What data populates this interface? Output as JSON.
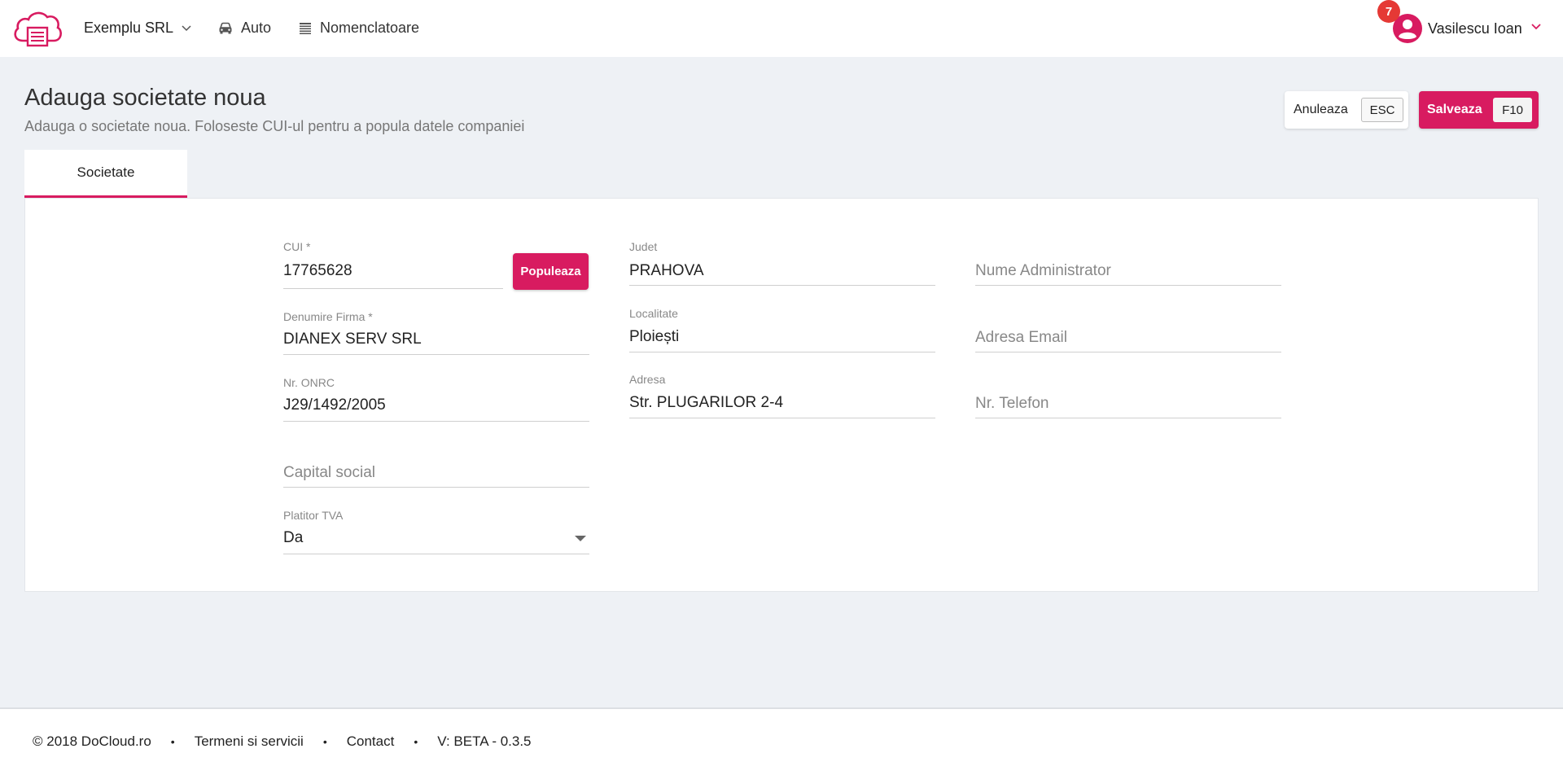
{
  "header": {
    "company": "Exemplu SRL",
    "nav": [
      {
        "label": "Auto",
        "icon": "car-icon"
      },
      {
        "label": "Nomenclatoare",
        "icon": "list-icon"
      }
    ],
    "notifications_count": "7",
    "user_name": "Vasilescu Ioan"
  },
  "page": {
    "title": "Adauga societate noua",
    "subtitle": "Adauga o societate noua. Foloseste CUI-ul pentru a popula datele companiei",
    "cancel_label": "Anuleaza",
    "cancel_key": "ESC",
    "save_label": "Salveaza",
    "save_key": "F10"
  },
  "tabs": [
    {
      "label": "Societate",
      "active": true
    }
  ],
  "form": {
    "cui": {
      "label": "CUI *",
      "value": "17765628"
    },
    "populate_label": "Populeaza",
    "denumire": {
      "label": "Denumire Firma *",
      "value": "DIANEX SERV SRL"
    },
    "onrc": {
      "label": "Nr. ONRC",
      "value": "J29/1492/2005"
    },
    "capital": {
      "placeholder": "Capital social"
    },
    "tva": {
      "label": "Platitor TVA",
      "value": "Da"
    },
    "judet": {
      "label": "Judet",
      "value": "PRAHOVA"
    },
    "localitate": {
      "label": "Localitate",
      "value": "Ploiești"
    },
    "adresa": {
      "label": "Adresa",
      "value": "Str. PLUGARILOR 2-4"
    },
    "administrator": {
      "placeholder": "Nume Administrator"
    },
    "email": {
      "placeholder": "Adresa Email"
    },
    "telefon": {
      "placeholder": "Nr. Telefon"
    }
  },
  "footer": {
    "copyright": "© 2018 DoCloud.ro",
    "terms": "Termeni si servicii",
    "contact": "Contact",
    "version": "V: BETA - 0.3.5"
  },
  "colors": {
    "accent": "#d81b60",
    "badge": "#e53935",
    "background": "#eef1f5"
  }
}
